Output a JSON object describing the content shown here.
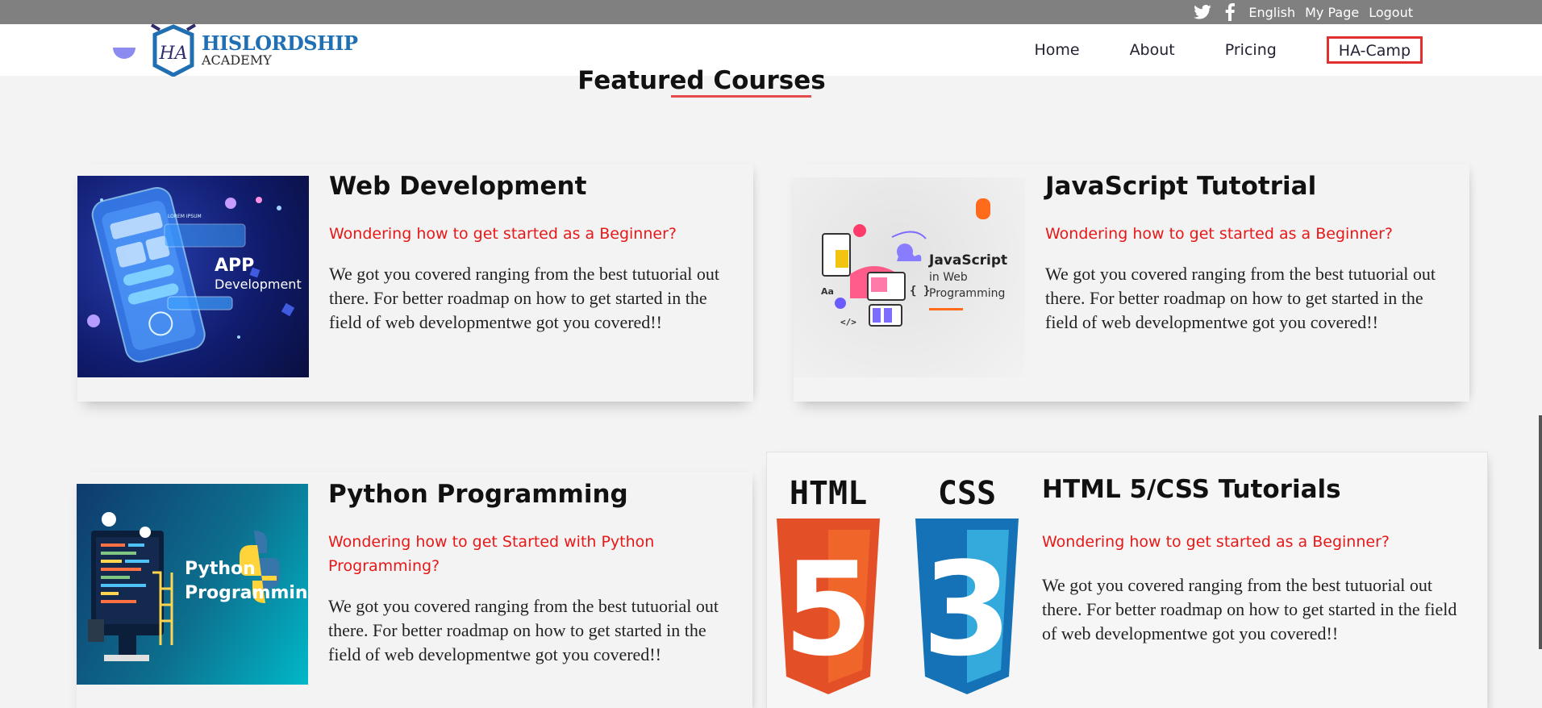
{
  "topbar": {
    "language": "English",
    "my_page": "My Page",
    "logout": "Logout"
  },
  "brand": {
    "monogram": "HA",
    "name_line1": "HISLORDSHIP",
    "name_line2": "ACADEMY"
  },
  "nav": {
    "home": "Home",
    "about": "About",
    "pricing": "Pricing",
    "ha_camp": "HA-Camp"
  },
  "page_title": "Featured Courses",
  "courses": [
    {
      "title": "Web Development",
      "subtitle": "Wondering how to get started as a Beginner?",
      "description": "We got you covered ranging from the best tutuorial out there. For better roadmap on how to get started in the field of web developmentwe got you covered!!",
      "thumb_line1": "APP",
      "thumb_line2": "Development",
      "thumb_small": "LOREM IPSUM"
    },
    {
      "title": "JavaScript Tutotrial",
      "subtitle": "Wondering how to get started as a Beginner?",
      "description": "We got you covered ranging from the best tutuorial out there. For better roadmap on how to get started in the field of web developmentwe got you covered!!",
      "thumb_line1": "JavaScript",
      "thumb_line2": "in Web",
      "thumb_line3": "Programming"
    },
    {
      "title": "Python Programming",
      "subtitle": "Wondering how to get Started with Python Programming?",
      "description": "We got you covered ranging from the best tutuorial out there. For better roadmap on how to get started in the field of web developmentwe got you covered!!",
      "thumb_line1": "Python",
      "thumb_line2": "Programming"
    },
    {
      "title": "HTML 5/CSS Tutorials",
      "subtitle": "Wondering how to get started as a Beginner?",
      "description": "We got you covered ranging from the best tutuorial out there. For better roadmap on how to get started in the field of web developmentwe got you covered!!",
      "thumb_html": "HTML",
      "thumb_css": "CSS",
      "thumb_five": "5",
      "thumb_three": "3"
    }
  ],
  "colors": {
    "topbar": "#808080",
    "accent_red": "#e81818",
    "underline": "#e74c4c",
    "brand_blue": "#1f6fb2"
  }
}
